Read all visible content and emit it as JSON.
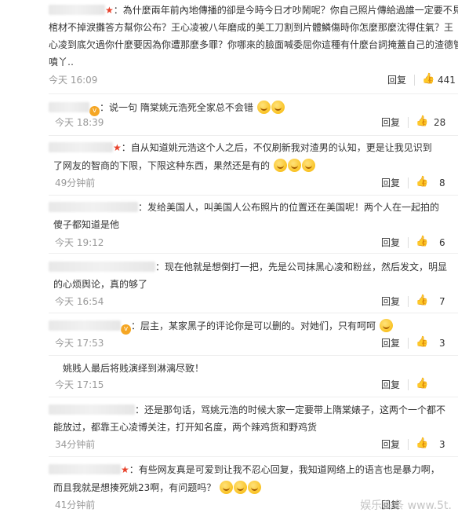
{
  "comments": [
    {
      "lines": [
        "：為什麼兩年前內地傳播的卻是今時今日才吵鬧呢？你自己照片傳給過誰一定要不見",
        "棺材不掉淚攤答方幫你公布？王心凌被八年磨成的美工刀割到片體鱗傷時你怎麼那麼沈得住氣？王",
        "心凌到底欠過你什麼要因為你遭那麼多罪？你哪來的臉面喊委屈你這種有什麼台詞掩蓋自己的渣德管",
        "噴丫‥"
      ],
      "time": "今天 16:09",
      "reply": "回复",
      "likes": "441"
    },
    {
      "lines": [
        "：说一句 隋棠姚元浩死全家总不会错"
      ],
      "time": "今天 18:39",
      "reply": "回复",
      "likes": "28"
    },
    {
      "lines": [
        "：自从知道姚元浩这个人之后，不仅刷新我对渣男的认知，更是让我见识到",
        "了网友的智商的下限，下限这种东西，果然还是有的"
      ],
      "time": "49分钟前",
      "reply": "回复",
      "likes": "8"
    },
    {
      "lines": [
        "：发给美国人，叫美国人公布照片的位置还在美国呢！两个人在一起拍的",
        "傻子都知道是他"
      ],
      "time": "今天 19:12",
      "reply": "回复",
      "likes": "6"
    },
    {
      "lines": [
        "：现在他就是想倒打一把，先是公司抹黑心凌和粉丝，然后发文，明显",
        "的心烦舆论，真的够了"
      ],
      "time": "今天 16:54",
      "reply": "回复",
      "likes": "7"
    },
    {
      "lines": [
        "：层主，某家黑子的评论你是可以删的。对她们，只有呵呵"
      ],
      "time": "今天 17:53",
      "reply": "回复",
      "likes": "3"
    },
    {
      "lines": [
        "姚贱人最后将贱演绎到淋漓尽致！"
      ],
      "time": "今天 17:15",
      "reply": "回复",
      "likes": ""
    },
    {
      "lines": [
        "：还是那句话，骂姚元浩的时候大家一定要带上隋棠婊子，这两个一个都不",
        "能放过，都靠王心凌博关注，打开知名度，两个辣鸡货和野鸡货"
      ],
      "time": "34分钟前",
      "reply": "回复",
      "likes": "3"
    },
    {
      "lines": [
        "：有些网友真是可爱到让我不忍心回复，我知道网络上的语言也是暴力啊，",
        "而且我就是想揍死姚23啊，有问题吗？"
      ],
      "time": "41分钟前",
      "reply": "回复",
      "likes": ""
    }
  ],
  "watermark": "娱乐头条 www.5t."
}
